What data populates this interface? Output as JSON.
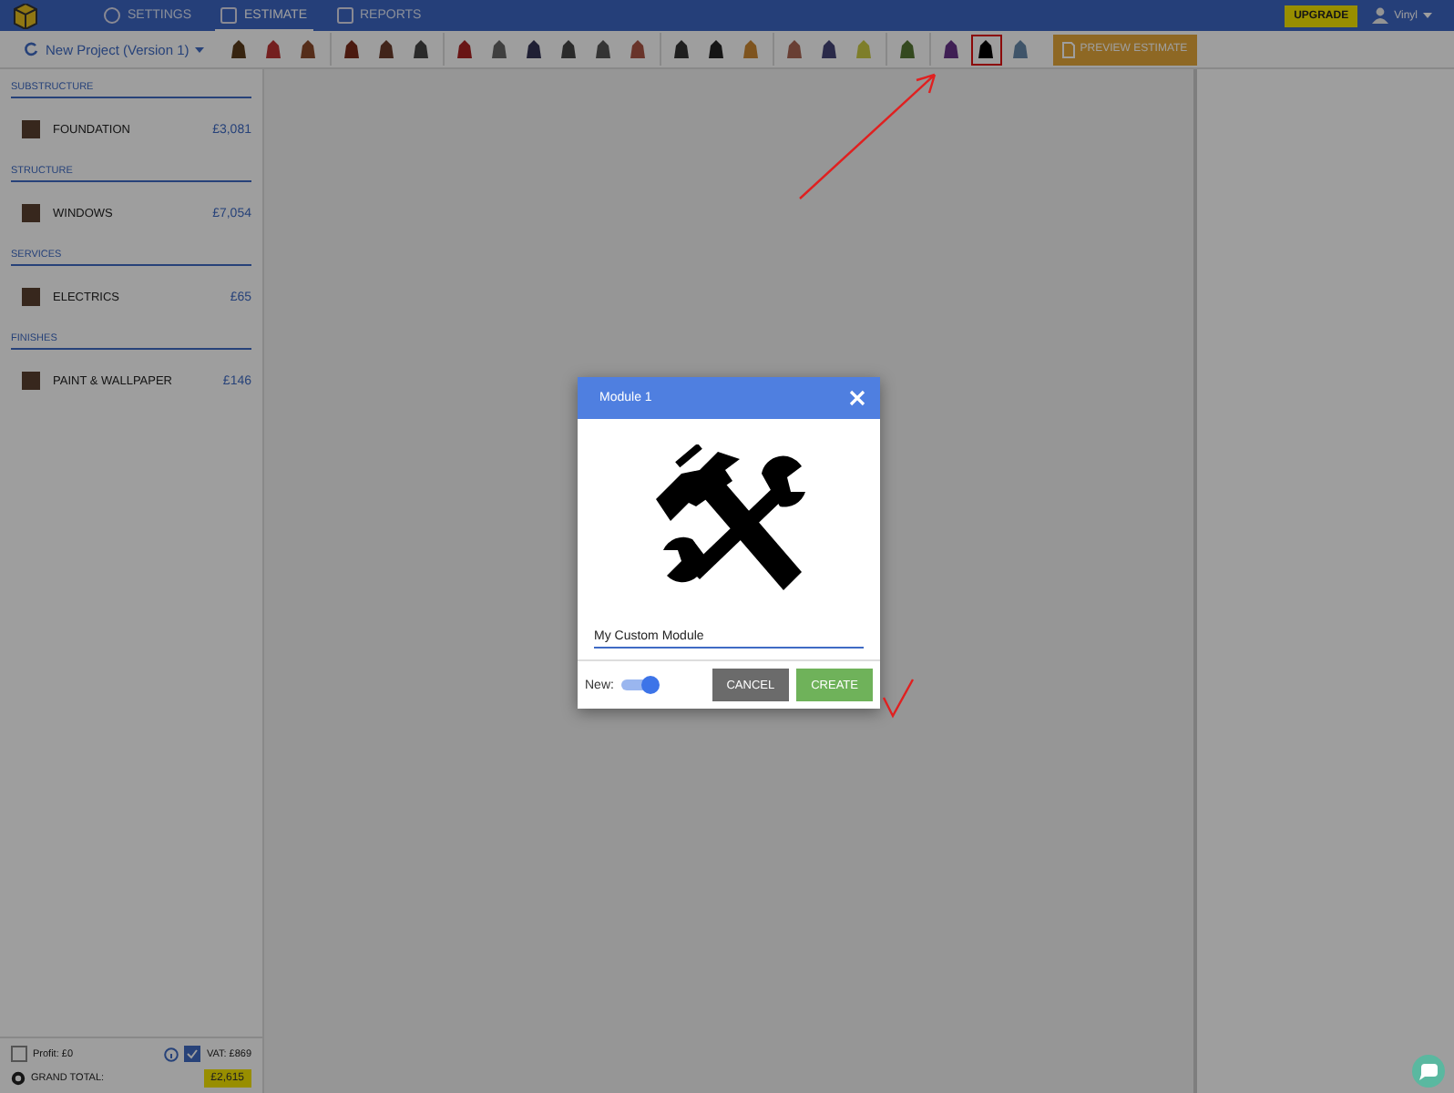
{
  "nav": {
    "tabs": [
      {
        "label": "SETTINGS",
        "selected": false
      },
      {
        "label": "ESTIMATE",
        "selected": true
      },
      {
        "label": "REPORTS",
        "selected": false
      }
    ],
    "upgrade": "UPGRADE",
    "user": "Vinyl"
  },
  "toolbar": {
    "project": "New Project (Version 1)",
    "tool_groups": [
      [
        {
          "highlighted": false
        },
        {
          "highlighted": false
        },
        {
          "highlighted": false
        }
      ],
      [
        {
          "highlighted": false
        },
        {
          "highlighted": false
        },
        {
          "highlighted": false
        }
      ],
      [
        {
          "highlighted": false
        },
        {
          "highlighted": false
        },
        {
          "highlighted": false
        },
        {
          "highlighted": false
        },
        {
          "highlighted": false
        },
        {
          "highlighted": false
        }
      ],
      [
        {
          "highlighted": false
        },
        {
          "highlighted": false
        },
        {
          "highlighted": false
        }
      ],
      [
        {
          "highlighted": false
        },
        {
          "highlighted": false
        },
        {
          "highlighted": false
        }
      ],
      [
        {
          "highlighted": false
        }
      ],
      [
        {
          "highlighted": false
        },
        {
          "highlighted": true
        },
        {
          "highlighted": false
        }
      ]
    ],
    "preview": "PREVIEW ESTIMATE"
  },
  "sidebar": {
    "sections": [
      {
        "title": "SUBSTRUCTURE",
        "items": [
          {
            "name": "FOUNDATION",
            "amount": "£3,081"
          }
        ]
      },
      {
        "title": "STRUCTURE",
        "items": [
          {
            "name": "WINDOWS",
            "amount": "£7,054"
          }
        ]
      },
      {
        "title": "SERVICES",
        "items": [
          {
            "name": "ELECTRICS",
            "amount": "£65"
          }
        ]
      },
      {
        "title": "FINISHES",
        "items": [
          {
            "name": "PAINT & WALLPAPER",
            "amount": "£146"
          }
        ]
      }
    ],
    "profit": {
      "label": "Profit: £0",
      "checked": false
    },
    "vat": {
      "label": "VAT: £869",
      "checked": true
    },
    "grand_total": {
      "label": "GRAND TOTAL:",
      "value": "£2,615"
    }
  },
  "modal": {
    "title": "Module 1",
    "value": "My Custom Module",
    "toggle_label": "New:",
    "toggle_on": true,
    "buttons": [
      {
        "label": "CANCEL",
        "kind": "cancel"
      },
      {
        "label": "CREATE",
        "kind": "create"
      }
    ]
  }
}
